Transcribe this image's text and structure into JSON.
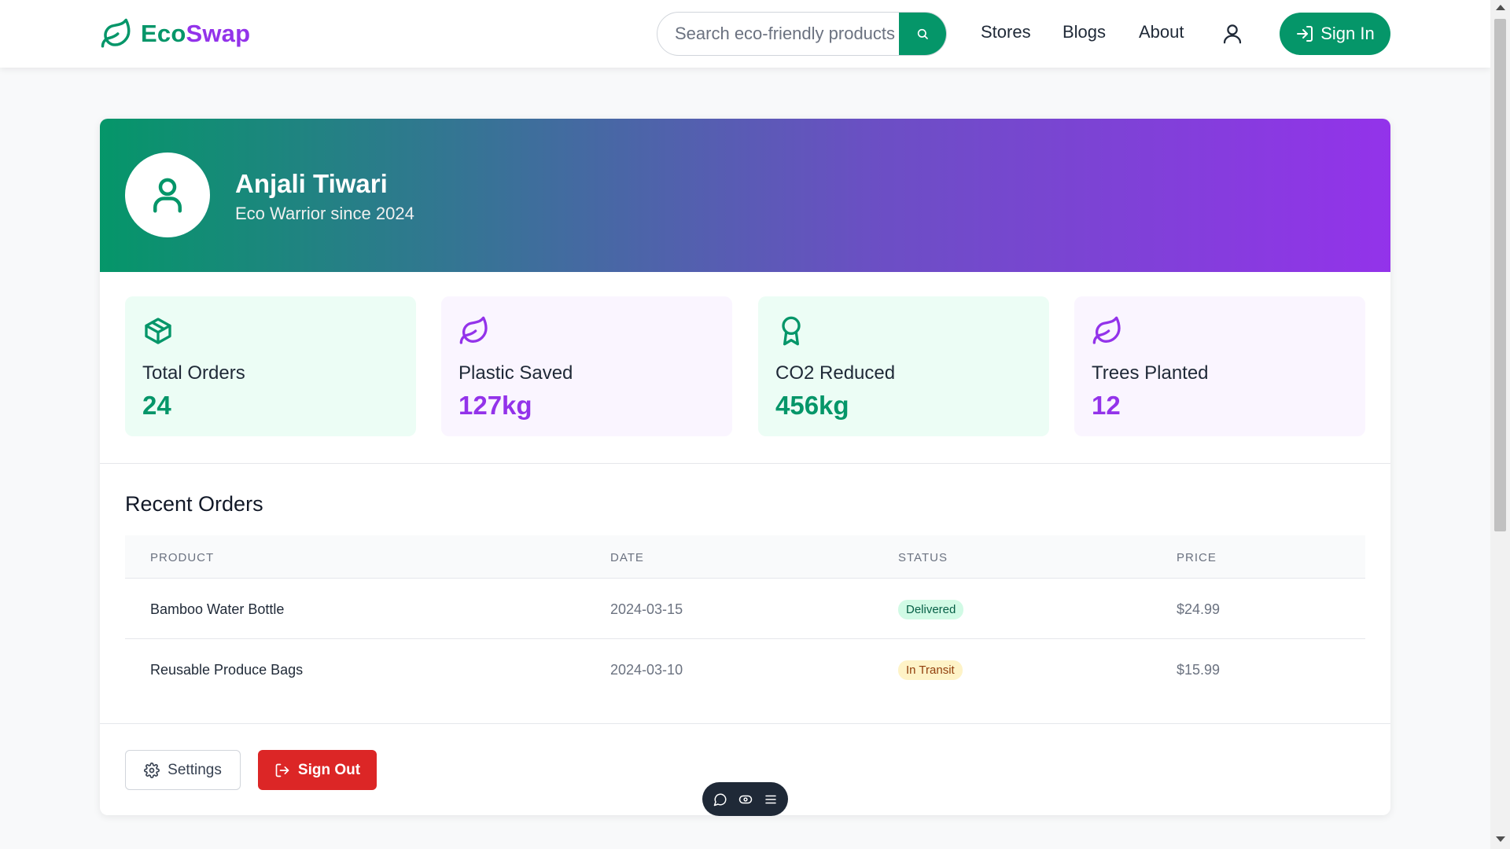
{
  "header": {
    "logo_part1": "Eco",
    "logo_part2": "Swap",
    "search_placeholder": "Search eco-friendly products",
    "nav": [
      "Stores",
      "Blogs",
      "About"
    ],
    "signin_label": "Sign In"
  },
  "profile": {
    "name": "Anjali Tiwari",
    "subtitle": "Eco Warrior since 2024"
  },
  "stats": [
    {
      "icon": "package-icon",
      "label": "Total Orders",
      "value": "24",
      "tone": "green"
    },
    {
      "icon": "leaf-icon",
      "label": "Plastic Saved",
      "value": "127kg",
      "tone": "purple"
    },
    {
      "icon": "award-icon",
      "label": "CO2 Reduced",
      "value": "456kg",
      "tone": "green"
    },
    {
      "icon": "leaf-icon",
      "label": "Trees Planted",
      "value": "12",
      "tone": "purple"
    }
  ],
  "orders": {
    "title": "Recent Orders",
    "columns": [
      "PRODUCT",
      "DATE",
      "STATUS",
      "PRICE"
    ],
    "rows": [
      {
        "product": "Bamboo Water Bottle",
        "date": "2024-03-15",
        "status": "Delivered",
        "price": "$24.99"
      },
      {
        "product": "Reusable Produce Bags",
        "date": "2024-03-10",
        "status": "In Transit",
        "price": "$15.99"
      }
    ]
  },
  "actions": {
    "settings_label": "Settings",
    "signout_label": "Sign Out"
  },
  "colors": {
    "primary_green": "#059669",
    "accent_purple": "#9333ea",
    "danger_red": "#dc2626"
  }
}
